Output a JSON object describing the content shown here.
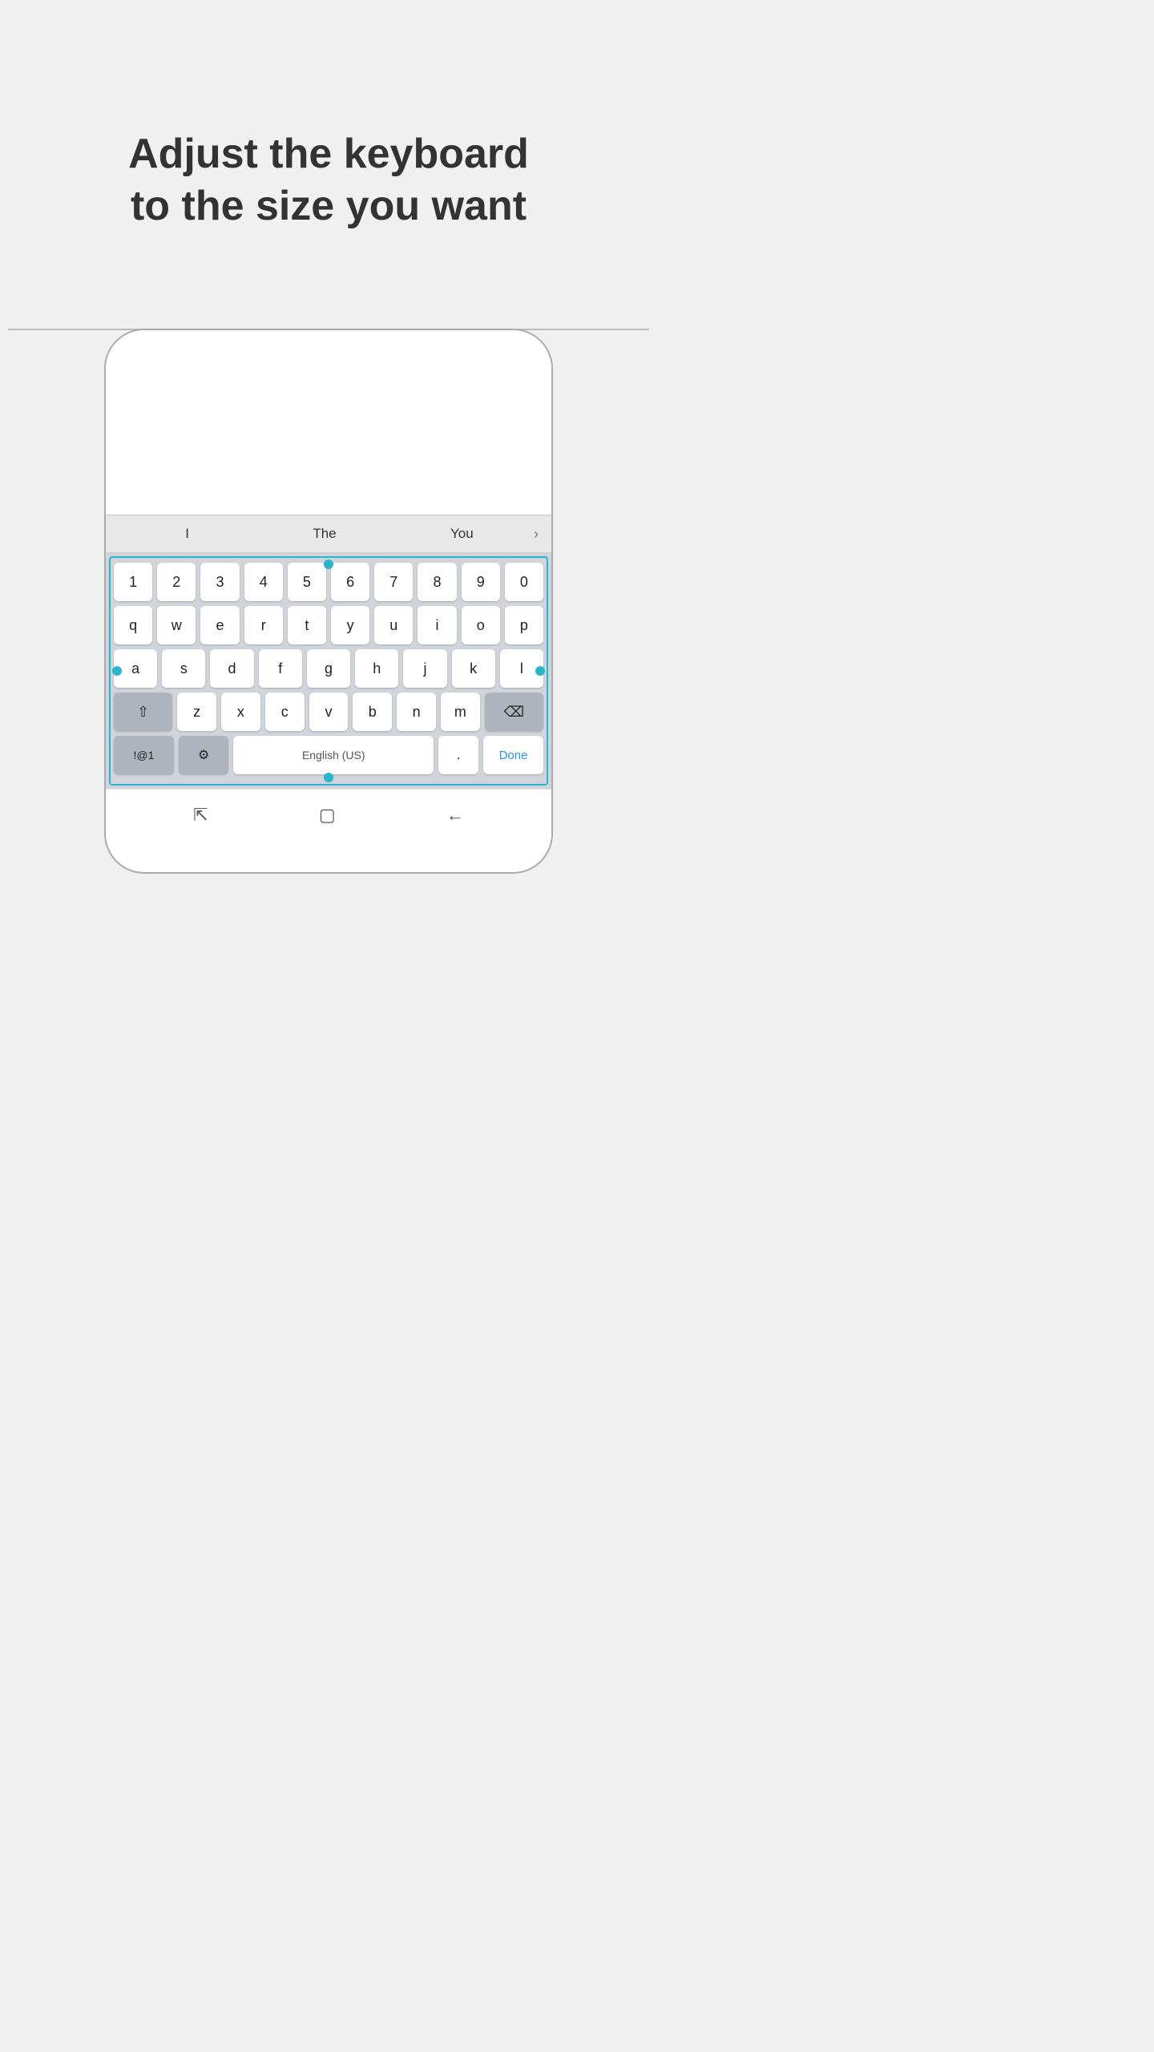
{
  "header": {
    "title_line1": "Adjust the keyboard",
    "title_line2": "to the size you want"
  },
  "suggestions": {
    "items": [
      "I",
      "The",
      "You"
    ],
    "arrow": "›"
  },
  "keyboard": {
    "rows": [
      [
        "1",
        "2",
        "3",
        "4",
        "5",
        "6",
        "7",
        "8",
        "9",
        "0"
      ],
      [
        "q",
        "w",
        "e",
        "r",
        "t",
        "y",
        "u",
        "i",
        "o",
        "p"
      ],
      [
        "a",
        "s",
        "d",
        "f",
        "g",
        "h",
        "j",
        "k",
        "l"
      ],
      [
        "z",
        "x",
        "c",
        "v",
        "b",
        "n",
        "m"
      ],
      [
        "!@1",
        "⚙",
        "English (US)",
        ".",
        "Done"
      ]
    ],
    "accent_color": "#29b6cc",
    "space_placeholder": "English (US)"
  },
  "navbar": {
    "icons": [
      "menu-icon",
      "home-icon",
      "back-icon"
    ]
  }
}
